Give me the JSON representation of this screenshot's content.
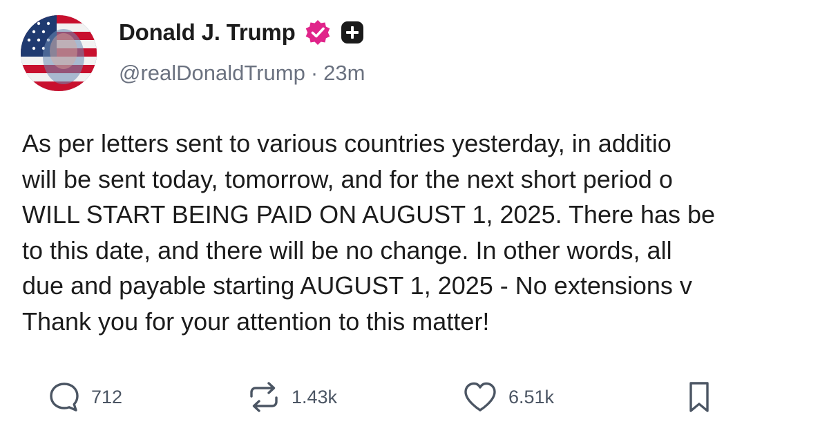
{
  "author": {
    "display_name": "Donald J. Trump",
    "handle": "@realDonaldTrump",
    "separator": "·",
    "time_ago": "23m"
  },
  "badges": {
    "verified_icon": "verified-badge-icon",
    "plus_icon": "plus-badge-icon",
    "verified_color": "#e0248a"
  },
  "post": {
    "lines": [
      "As per letters sent to various countries yesterday, in additio",
      "will be sent today, tomorrow, and for the next short period o",
      "WILL START BEING PAID ON AUGUST 1, 2025. There has be",
      "to this date, and there will be no change. In other words, all",
      "due and payable starting AUGUST 1, 2025 - No extensions v",
      "Thank you for your attention to this matter!"
    ]
  },
  "actions": {
    "reply": {
      "icon": "reply-icon",
      "count": "712"
    },
    "retruth": {
      "icon": "retruth-icon",
      "count": "1.43k"
    },
    "like": {
      "icon": "heart-icon",
      "count": "6.51k"
    },
    "bookmark": {
      "icon": "bookmark-icon"
    }
  }
}
